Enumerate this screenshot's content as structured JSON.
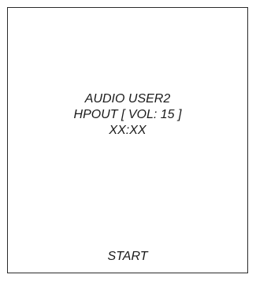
{
  "display": {
    "lines": [
      "AUDIO USER2",
      "HPOUT [ VOL: 15 ]",
      "XX:XX"
    ],
    "softkey_label": "START"
  },
  "colors": {
    "border": "#2b2b2b",
    "text": "#1a1a1a",
    "background": "#ffffff"
  }
}
